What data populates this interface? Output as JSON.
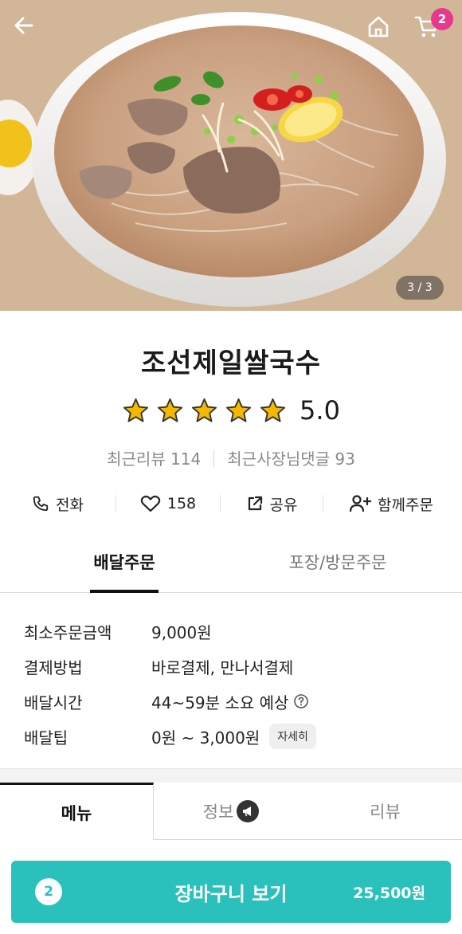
{
  "hero": {
    "image_counter": "3 / 3",
    "cart_badge": "2",
    "icons": [
      "back-arrow-icon",
      "home-icon",
      "cart-icon"
    ]
  },
  "store": {
    "name": "조선제일쌀국수",
    "rating": 5.0,
    "rating_label": "5.0",
    "stars": 5,
    "recent_reviews": "최근리뷰 114",
    "owner_replies": "최근사장님댓글 93"
  },
  "actions": [
    {
      "icon": "phone-icon",
      "label": "전화"
    },
    {
      "icon": "heart-icon",
      "label": "158"
    },
    {
      "icon": "share-icon",
      "label": "공유"
    },
    {
      "icon": "add-person-icon",
      "label": "함께주문"
    }
  ],
  "order_tabs": {
    "delivery": "배달주문",
    "pickup": "포장/방문주문"
  },
  "info": {
    "min_order_label": "최소주문금액",
    "min_order_value": "9,000원",
    "payment_label": "결제방법",
    "payment_value": "바로결제, 만나서결제",
    "delivery_time_label": "배달시간",
    "delivery_time_value": "44~59분 소요 예상",
    "delivery_tip_label": "배달팁",
    "delivery_tip_value": "0원 ~ 3,000원",
    "detail_button": "자세히"
  },
  "menu_tabs": {
    "menu": "메뉴",
    "info": "정보",
    "review": "리뷰"
  },
  "cart": {
    "count": "2",
    "label": "장바구니 보기",
    "total": "25,500원"
  },
  "colors": {
    "accent": "#2ac1bc",
    "badge": "#e6398d",
    "star": "#f5b800"
  }
}
